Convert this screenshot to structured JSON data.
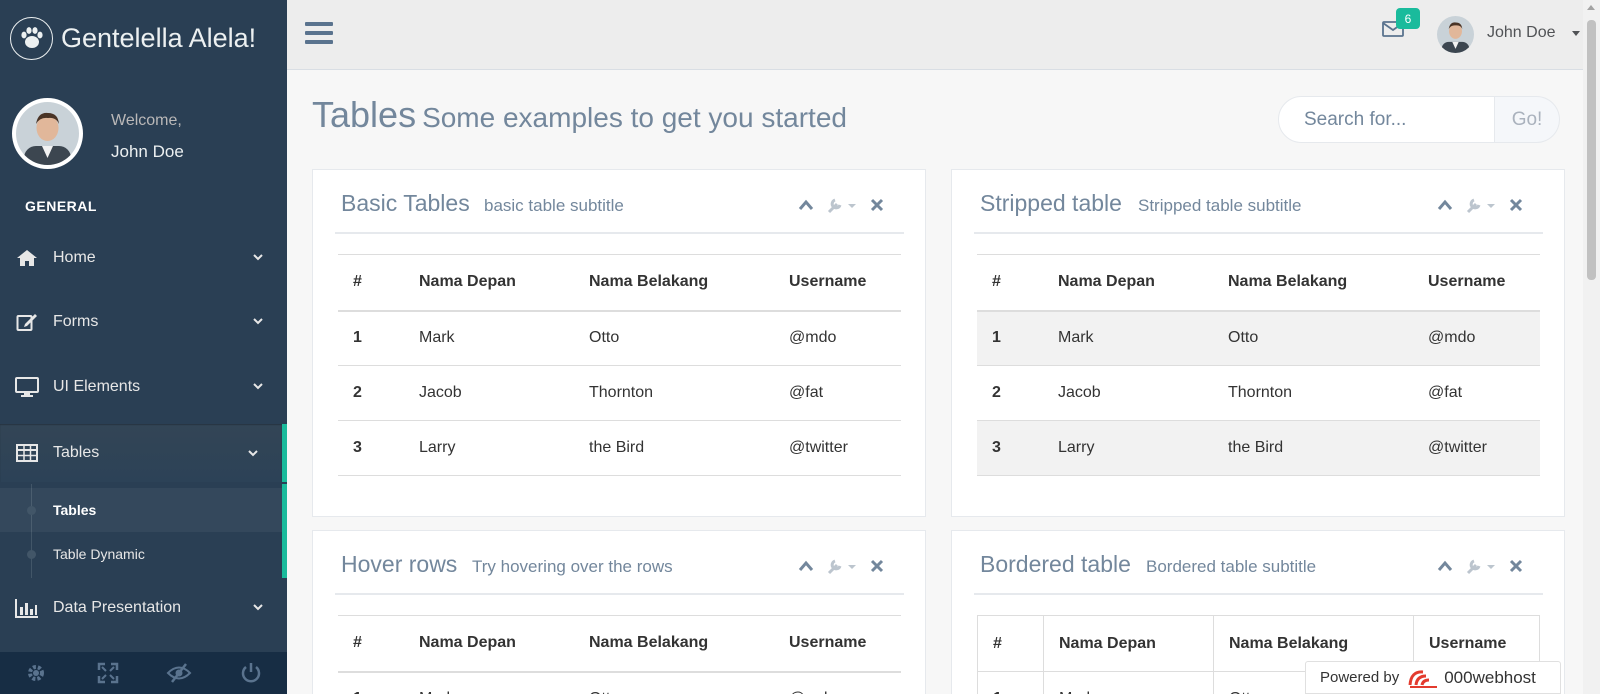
{
  "brand": {
    "title": "Gentelella Alela!",
    "logo_icon": "paw-icon"
  },
  "profile": {
    "welcome": "Welcome,",
    "name": "John Doe"
  },
  "sidebar": {
    "section": "GENERAL",
    "items": [
      {
        "label": "Home",
        "icon": "home-icon"
      },
      {
        "label": "Forms",
        "icon": "edit-icon"
      },
      {
        "label": "UI Elements",
        "icon": "desktop-icon"
      },
      {
        "label": "Tables",
        "icon": "table-icon",
        "active": true
      },
      {
        "label": "Data Presentation",
        "icon": "bar-chart-icon"
      }
    ],
    "submenu": [
      {
        "label": "Tables",
        "current": true
      },
      {
        "label": "Table Dynamic"
      }
    ],
    "footer_icons": [
      "gear-icon",
      "fullscreen-icon",
      "eye-slash-icon",
      "power-icon"
    ]
  },
  "topnav": {
    "mail_count": "6",
    "user_name": "John Doe"
  },
  "page": {
    "title": "Tables",
    "subtitle": "Some examples to get you started"
  },
  "search": {
    "placeholder": "Search for...",
    "button": "Go!"
  },
  "columns": [
    "#",
    "Nama Depan",
    "Nama Belakang",
    "Username"
  ],
  "rows": [
    [
      "1",
      "Mark",
      "Otto",
      "@mdo"
    ],
    [
      "2",
      "Jacob",
      "Thornton",
      "@fat"
    ],
    [
      "3",
      "Larry",
      "the Bird",
      "@twitter"
    ]
  ],
  "panels": {
    "basic": {
      "title": "Basic Tables",
      "subtitle": "basic table subtitle"
    },
    "striped": {
      "title": "Stripped table",
      "subtitle": "Stripped table subtitle"
    },
    "hover": {
      "title": "Hover rows",
      "subtitle": "Try hovering over the rows"
    },
    "bordered": {
      "title": "Bordered table",
      "subtitle": "Bordered table subtitle"
    }
  },
  "watermark": {
    "prefix": "Powered by",
    "brand": "000webhost"
  },
  "colors": {
    "sidebar": "#2A3F54",
    "accent": "#1ABB9C",
    "text": "#73879C"
  }
}
